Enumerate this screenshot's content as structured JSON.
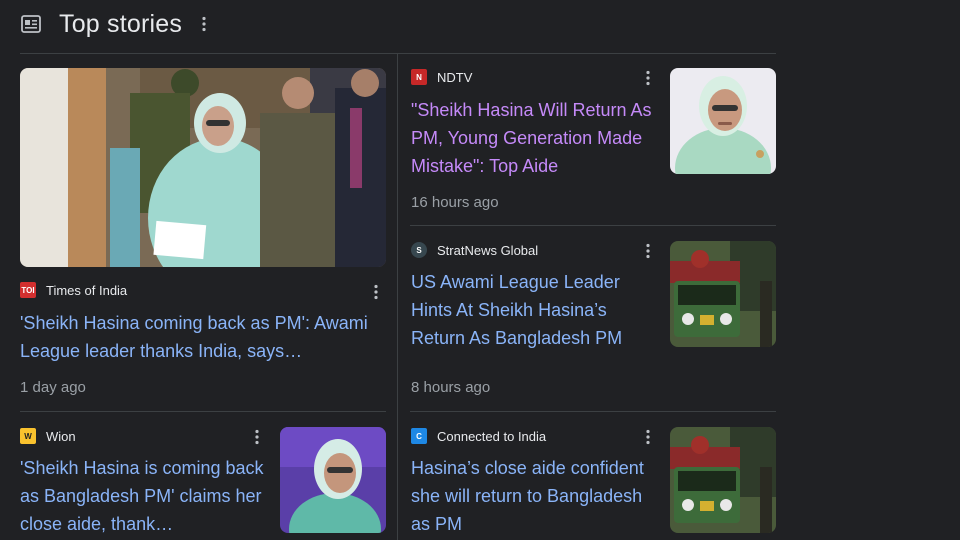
{
  "header": {
    "title": "Top stories",
    "icon": "newspaper-icon"
  },
  "stories": [
    {
      "source": "Times of India",
      "favicon_text": "TOI",
      "favicon_color": "#d32f2f",
      "headline": "'Sheikh Hasina coming back as PM': Awami League leader thanks India, says…",
      "time": "1 day ago"
    },
    {
      "source": "NDTV",
      "favicon_text": "N",
      "favicon_color": "#c62828",
      "headline": "\"Sheikh Hasina Will Return As PM, Young Generation Made Mistake\": Top Aide",
      "time": "16 hours ago",
      "visited": true
    },
    {
      "source": "StratNews Global",
      "favicon_text": "S",
      "favicon_color": "#37474f",
      "headline": "US Awami League Leader Hints At Sheikh Hasina’s Return As Bangladesh PM",
      "time": "8 hours ago"
    },
    {
      "source": "Wion",
      "favicon_text": "W",
      "favicon_color": "#f9c22e",
      "headline": "'Sheikh Hasina is coming back as Bangladesh PM' claims her close aide, thank…",
      "time": ""
    },
    {
      "source": "Connected to India",
      "favicon_text": "C",
      "favicon_color": "#1e88e5",
      "headline": "Hasina’s close aide confident she will return to Bangladesh as PM",
      "time": ""
    }
  ],
  "colors": {
    "background": "#202124",
    "link": "#8ab4f8",
    "visited_link": "#c58af9",
    "secondary_text": "#9aa0a6",
    "divider": "#3c4043"
  }
}
